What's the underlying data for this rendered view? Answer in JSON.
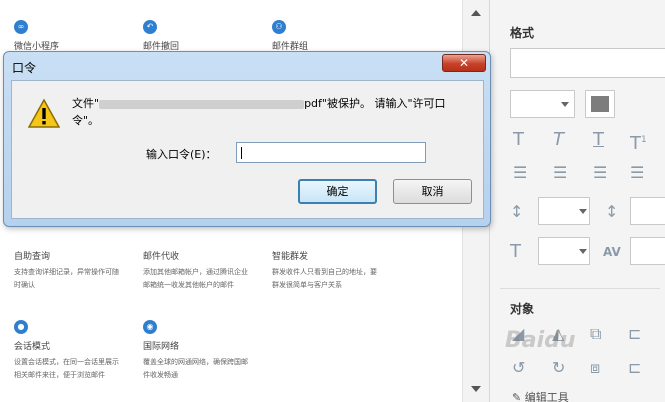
{
  "background": {
    "features": [
      {
        "name": "微信小程序",
        "icon": "link-icon",
        "glyph": "∞"
      },
      {
        "name": "邮件撤回",
        "icon": "undo-icon",
        "glyph": "↶"
      },
      {
        "name": "邮件群组",
        "icon": "group-icon",
        "glyph": "⚇"
      },
      {
        "name": "自助查询",
        "icon": "search-icon",
        "glyph": "",
        "desc": [
          "支持查询详细记录，异常操作可随",
          "时确认"
        ]
      },
      {
        "name": "邮件代收",
        "icon": "inbox-icon",
        "glyph": "",
        "desc": [
          "添加其他邮箱帐户，通过腾讯企业",
          "邮箱统一收发其他帐户的邮件"
        ]
      },
      {
        "name": "智能群发",
        "icon": "broadcast-icon",
        "glyph": "",
        "desc": [
          "群发收件人只看到自己的地址，要",
          "群发很简单与客户关系"
        ]
      },
      {
        "name": "会话模式",
        "icon": "chat-icon",
        "glyph": "",
        "desc": [
          "设置会话模式，在同一会话里展示",
          "相关邮件来往，便于浏览邮件"
        ]
      },
      {
        "name": "国际网络",
        "icon": "globe-icon",
        "glyph": "",
        "desc": [
          "覆盖全球的网通网络，确保跨国邮",
          "件收发畅通"
        ]
      }
    ]
  },
  "format_panel": {
    "format_heading": "格式",
    "object_heading": "对象",
    "bottom_label": "编辑工具"
  },
  "dialog": {
    "title": "口令",
    "close_glyph": "✕",
    "message_prefix": "文件\"",
    "message_suffix": "pdf\"被保护。 请输入\"许可口令\"。",
    "password_label": "输入口令(E)：",
    "password_value": "",
    "ok_label": "确定",
    "cancel_label": "取消"
  },
  "watermark": "Baidu"
}
